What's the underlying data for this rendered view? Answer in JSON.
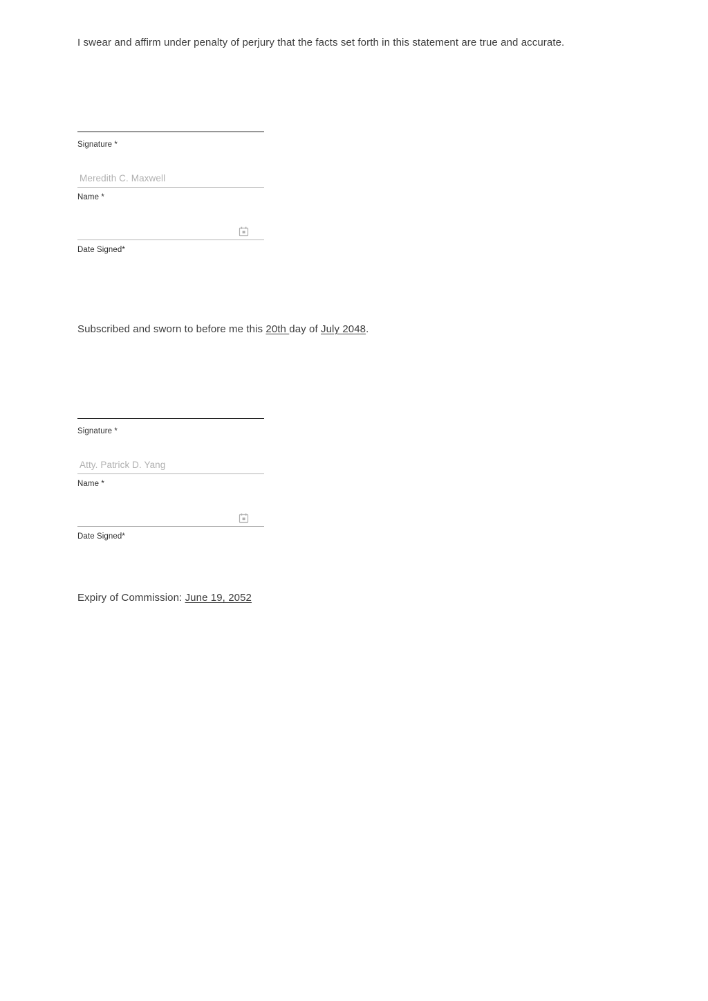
{
  "document": {
    "oath_statement": "I swear and affirm under penalty of perjury that the facts set forth in this statement are true and accurate.",
    "sworn_statement": {
      "lead": "Subscribed and sworn to before me this ",
      "day": "20th ",
      "middle": "day of ",
      "month_year": "July 2048",
      "trailing": "."
    },
    "expiry_statement": {
      "label": "Expiry of Commission: ",
      "date": "June 19, 2052"
    }
  },
  "affiant_block": {
    "signature_label": "Signature *",
    "name_label": "Name *",
    "name_value": "Meredith C. Maxwell",
    "date_label": "Date Signed*",
    "date_value": "",
    "calendar_icon": "calendar-icon"
  },
  "notary_block": {
    "signature_label": "Signature *",
    "name_label": "Name *",
    "name_value": "Atty. Patrick D. Yang",
    "date_label": "Date Signed*",
    "date_value": "",
    "calendar_icon": "calendar-icon"
  },
  "colors": {
    "body_text": "#3c3c3c",
    "label_text": "#2e2e2e",
    "placeholder_text": "#b0b0b0",
    "signature_rule": "#1c1c1c",
    "input_underline": "#b3b3b3",
    "icon": "#b0b0b0",
    "background": "#ffffff"
  }
}
